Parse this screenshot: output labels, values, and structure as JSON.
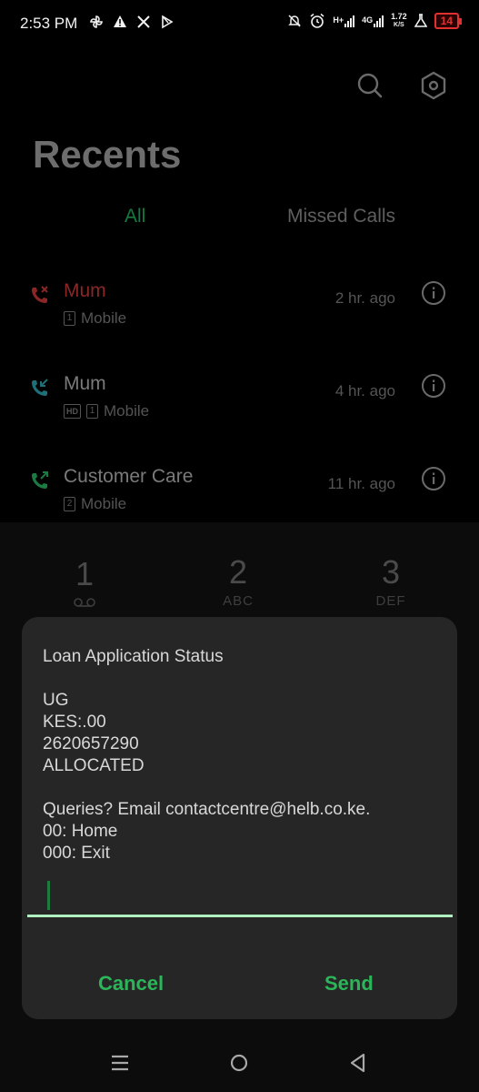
{
  "status_bar": {
    "time": "2:53 PM",
    "left_icons": [
      "pinwheel-icon",
      "warning-icon",
      "x-logo-icon",
      "play-store-icon"
    ],
    "right_icons": [
      "mute-bell-icon",
      "alarm-icon",
      "signal-h-plus-icon",
      "signal-4g-icon"
    ],
    "net_type_1": "H+",
    "net_type_2": "4G",
    "speed_value": "1.72",
    "speed_unit": "K/S",
    "battery": "14",
    "battery_color": "#e03030"
  },
  "header": {
    "title": "Recents",
    "search_icon": "search-icon",
    "settings_icon": "settings-hex-icon"
  },
  "tabs": [
    {
      "label": "All",
      "active": true
    },
    {
      "label": "Missed Calls",
      "active": false
    }
  ],
  "calls": [
    {
      "name": "Mum",
      "type": "missed",
      "sim": "1",
      "hd": false,
      "line": "Mobile",
      "time": "2 hr. ago",
      "icon": "missed-call-icon"
    },
    {
      "name": "Mum",
      "type": "incoming",
      "sim": "1",
      "hd": true,
      "hd_label": "HD",
      "line": "Mobile",
      "time": "4 hr. ago",
      "icon": "incoming-call-icon"
    },
    {
      "name": "Customer Care",
      "type": "outgoing",
      "sim": "2",
      "hd": false,
      "line": "Mobile",
      "time": "11 hr. ago",
      "icon": "outgoing-call-icon"
    }
  ],
  "dialpad": {
    "keys": [
      {
        "num": "1",
        "sub": "voicemail-icon"
      },
      {
        "num": "2",
        "sub": "ABC"
      },
      {
        "num": "3",
        "sub": "DEF"
      }
    ]
  },
  "dialog": {
    "message": "Loan Application Status\n\nUG\nKES:.00\n2620657290\nALLOCATED\n\nQueries? Email contactcentre@helb.co.ke.\n00: Home\n000: Exit",
    "input_value": "",
    "cancel_label": "Cancel",
    "send_label": "Send",
    "accent": "#2bb659"
  },
  "navbar": {
    "icons": [
      "menu-icon",
      "home-icon",
      "back-icon"
    ]
  }
}
